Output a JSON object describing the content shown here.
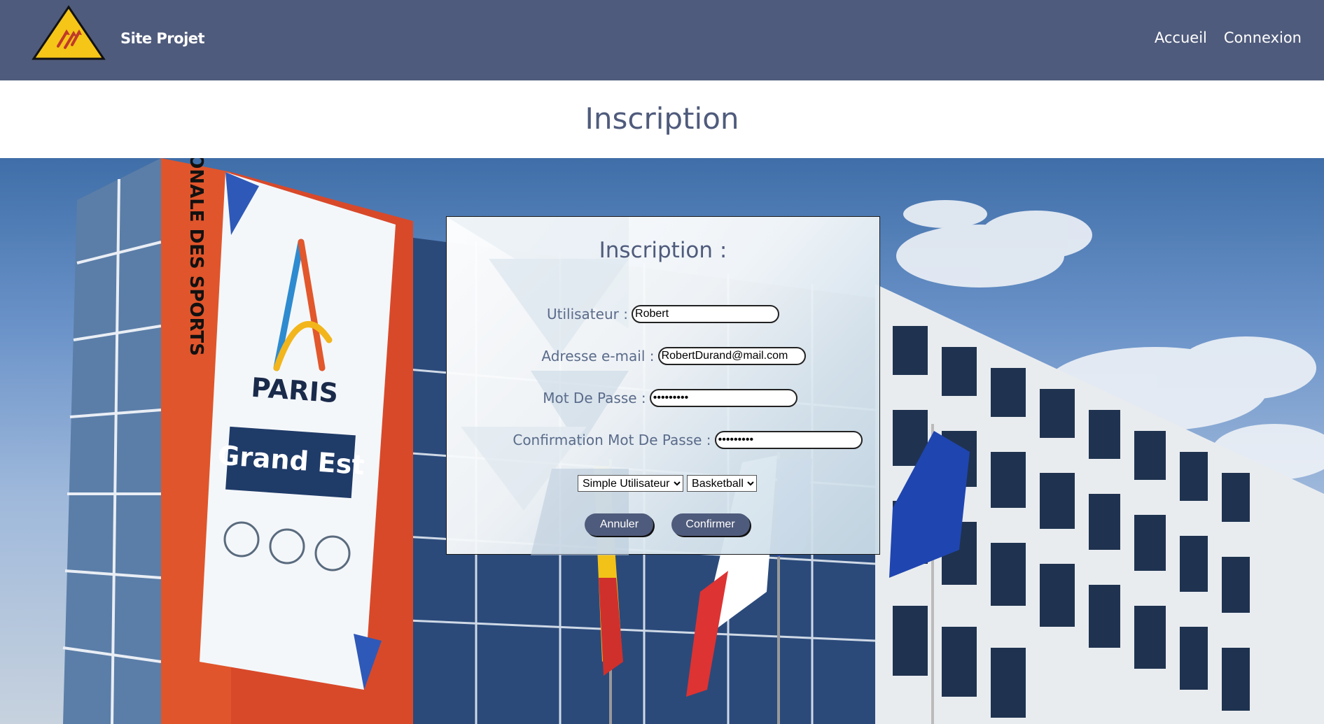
{
  "navbar": {
    "site_title": "Site Projet",
    "links": [
      "Accueil",
      "Connexion"
    ],
    "color": "#4f5b7c"
  },
  "page": {
    "title": "Inscription"
  },
  "form": {
    "title": "Inscription :",
    "fields": {
      "username": {
        "label": "Utilisateur :",
        "value": "Robert"
      },
      "email": {
        "label": "Adresse e-mail :",
        "value": "RobertDurand@mail.com"
      },
      "password": {
        "label": "Mot De Passe :",
        "value": "•••••••••"
      },
      "password_confirm": {
        "label": "Confirmation Mot De Passe :",
        "value": "•••••••••"
      }
    },
    "role_select": {
      "selected": "Simple Utilisateur"
    },
    "sport_select": {
      "selected": "Basketball"
    },
    "buttons": {
      "cancel": "Annuler",
      "confirm": "Confirmer"
    }
  },
  "background": {
    "building_sign_vertical": "MAISON REGIONALE DES SPORTS",
    "banner_city": "PARIS",
    "banner_region": "Grand Est"
  },
  "icons": {
    "logo": "yellow-triangle-logo-icon"
  }
}
